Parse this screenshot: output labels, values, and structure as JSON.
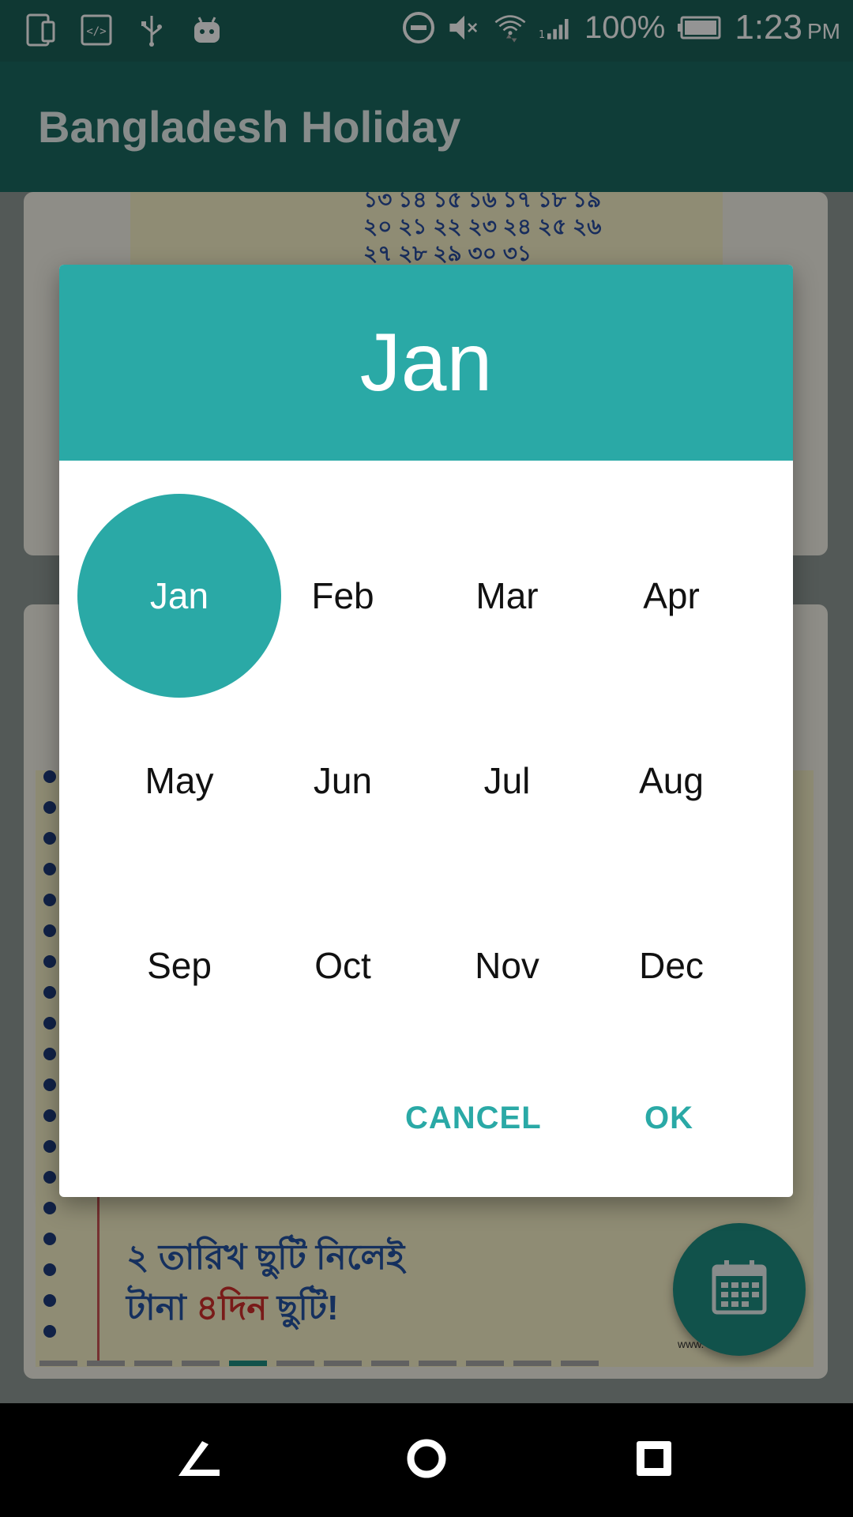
{
  "status_bar": {
    "battery_percent": "100%",
    "time": "1:23",
    "ampm": "PM",
    "icons_left": [
      "phone-icon",
      "code-icon",
      "usb-icon",
      "android-icon"
    ],
    "icons_right": [
      "do-not-disturb-icon",
      "mute-icon",
      "wifi-icon",
      "signal-icon",
      "battery-icon"
    ]
  },
  "app_bar": {
    "title": "Bangladesh Holiday"
  },
  "background": {
    "calendar_rows": [
      "১৩ ১৪ ১৫ ১৬ ১৭ ১৮ ১৯",
      "২০ ২১ ২২ ২৩ ২৪ ২৫ ২৬",
      "২৭ ২৮ ২৯ ৩০ ৩১"
    ],
    "ad_line1": "২ তারিখ ছুটি নিলেই",
    "ad_line2_start": "টানা ",
    "ad_line2_highlight": "৪দিন",
    "ad_line2_end": " ছুটি!",
    "ad_url": "www.          s.com",
    "pager_count": 12,
    "pager_active_index": 4
  },
  "dialog": {
    "header_title": "Jan",
    "months": [
      "Jan",
      "Feb",
      "Mar",
      "Apr",
      "May",
      "Jun",
      "Jul",
      "Aug",
      "Sep",
      "Oct",
      "Nov",
      "Dec"
    ],
    "selected_month": "Jan",
    "cancel_label": "CANCEL",
    "ok_label": "OK"
  },
  "fab": {
    "icon": "calendar-icon"
  },
  "colors": {
    "accent": "#2aa9a6",
    "app_bar": "#1b6a61",
    "status_bar": "#1a6158",
    "fab": "#1e8d82"
  }
}
